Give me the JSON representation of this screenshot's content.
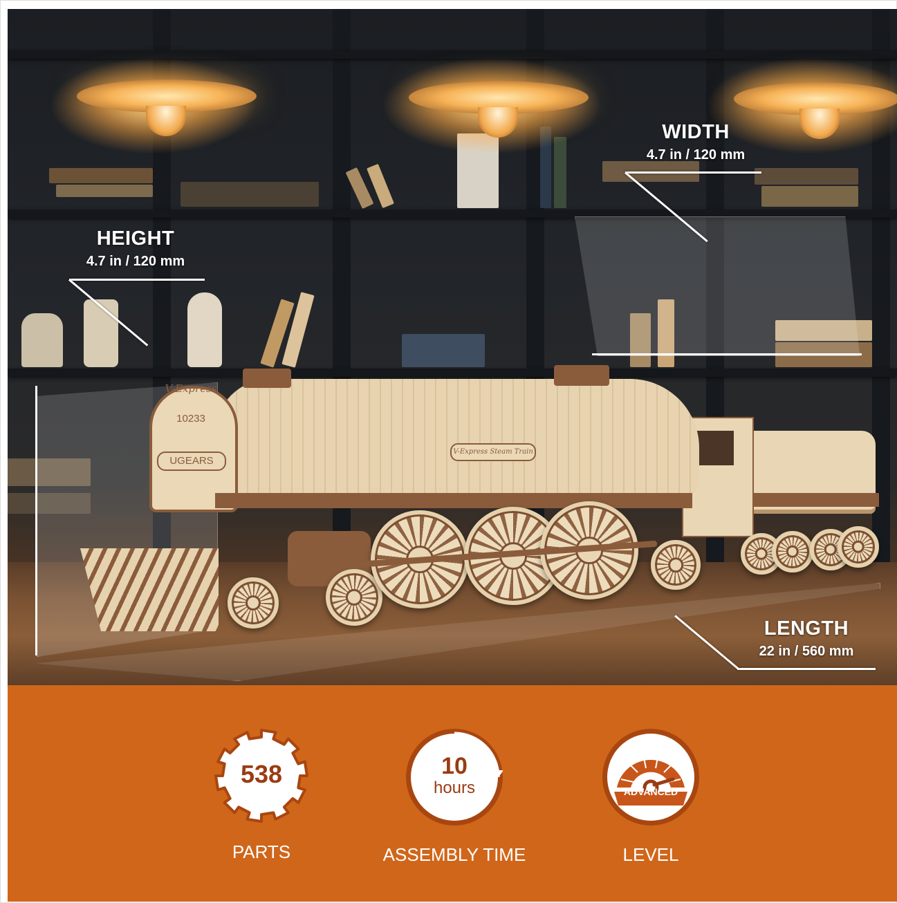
{
  "dimensions": {
    "height": {
      "title": "HEIGHT",
      "value": "4.7 in / 120 mm"
    },
    "width": {
      "title": "WIDTH",
      "value": "4.7 in / 120 mm"
    },
    "length": {
      "title": "LENGTH",
      "value": "22 in / 560 mm"
    }
  },
  "train": {
    "plate_name": "V-Express",
    "number": "10233",
    "brand": "UGEARS",
    "side_plate": "V-Express Steam Train"
  },
  "specs": {
    "parts": {
      "value": "538",
      "label": "PARTS"
    },
    "assembly": {
      "value": "10",
      "unit": "hours",
      "label": "ASSEMBLY TIME"
    },
    "level": {
      "badge": "ADVANCED",
      "label": "LEVEL"
    }
  },
  "colors": {
    "banner": "#d0661a",
    "badge_text": "#9b3b12",
    "badge_ring": "#a84610"
  },
  "icons": [
    "gear-badge-icon",
    "clock-badge-icon",
    "speedometer-icon"
  ]
}
